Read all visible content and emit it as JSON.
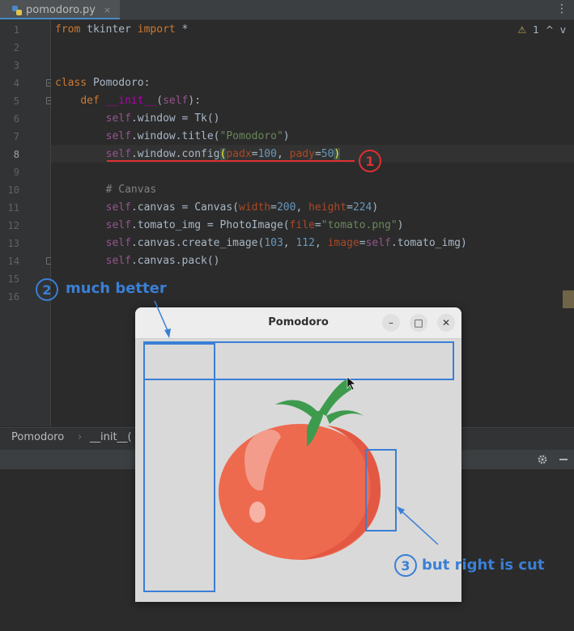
{
  "tab": {
    "filename": "pomodoro.py",
    "close": "×"
  },
  "toolbar": {
    "more": "⋮"
  },
  "inspections": {
    "warning_count": "1",
    "up": "^",
    "down": "v"
  },
  "line_numbers": [
    "1",
    "2",
    "3",
    "4",
    "5",
    "6",
    "7",
    "8",
    "9",
    "10",
    "11",
    "12",
    "13",
    "14",
    "15",
    "16"
  ],
  "current_line": "8",
  "code": {
    "l1": {
      "kw1": "from",
      "mod": " tkinter ",
      "kw2": "import",
      "rest": " *"
    },
    "l4": {
      "kw": "class",
      "name": " Pomodoro:"
    },
    "l5": {
      "indent": "    ",
      "kw": "def",
      "sp": " ",
      "name": "__init__",
      "p1": "(",
      "self": "self",
      "p2": "):"
    },
    "l6": {
      "indent": "        ",
      "self": "self",
      "rest": ".window = Tk()"
    },
    "l7": {
      "indent": "        ",
      "self": "self",
      "rest": ".window.title(",
      "str": "\"Pomodoro\"",
      "close": ")"
    },
    "l8": {
      "indent": "        ",
      "self": "self",
      "rest": ".window.config",
      "open": "(",
      "k1": "padx",
      "eq1": "=",
      "v1": "100",
      "sep": ", ",
      "k2": "pady",
      "eq2": "=",
      "v2": "50",
      "close": ")"
    },
    "l10": {
      "indent": "        ",
      "comment": "# Canvas"
    },
    "l11": {
      "indent": "        ",
      "self": "self",
      "rest": ".canvas = Canvas(",
      "k1": "width",
      "eq1": "=",
      "v1": "200",
      "sep": ", ",
      "k2": "height",
      "eq2": "=",
      "v2": "224",
      "close": ")"
    },
    "l12": {
      "indent": "        ",
      "self": "self",
      "rest": ".tomato_img = PhotoImage(",
      "k1": "file",
      "eq1": "=",
      "str": "\"tomato.png\"",
      "close": ")"
    },
    "l13": {
      "indent": "        ",
      "self": "self",
      "rest": ".canvas.create_image(",
      "v1": "103",
      "sep1": ", ",
      "v2": "112",
      "sep2": ", ",
      "k1": "image",
      "eq1": "=",
      "self2": "self",
      "rest2": ".tomato_img)"
    },
    "l14": {
      "indent": "        ",
      "self": "self",
      "rest": ".canvas.pack()"
    }
  },
  "breadcrumb": {
    "item1": "Pomodoro",
    "sep": "›",
    "item2": "__init__("
  },
  "tk_window": {
    "title": "Pomodoro",
    "minimize": "–",
    "maximize": "□",
    "close": "✕"
  },
  "annotations": {
    "a1": {
      "num": "1"
    },
    "a2": {
      "num": "2",
      "text": "much better"
    },
    "a3": {
      "num": "3",
      "text": "but right is cut"
    }
  },
  "colors": {
    "annotation_blue": "#3a7fd5",
    "annotation_red": "#e03030",
    "tomato": "#f0604a",
    "leaf": "#3e9b4e"
  }
}
